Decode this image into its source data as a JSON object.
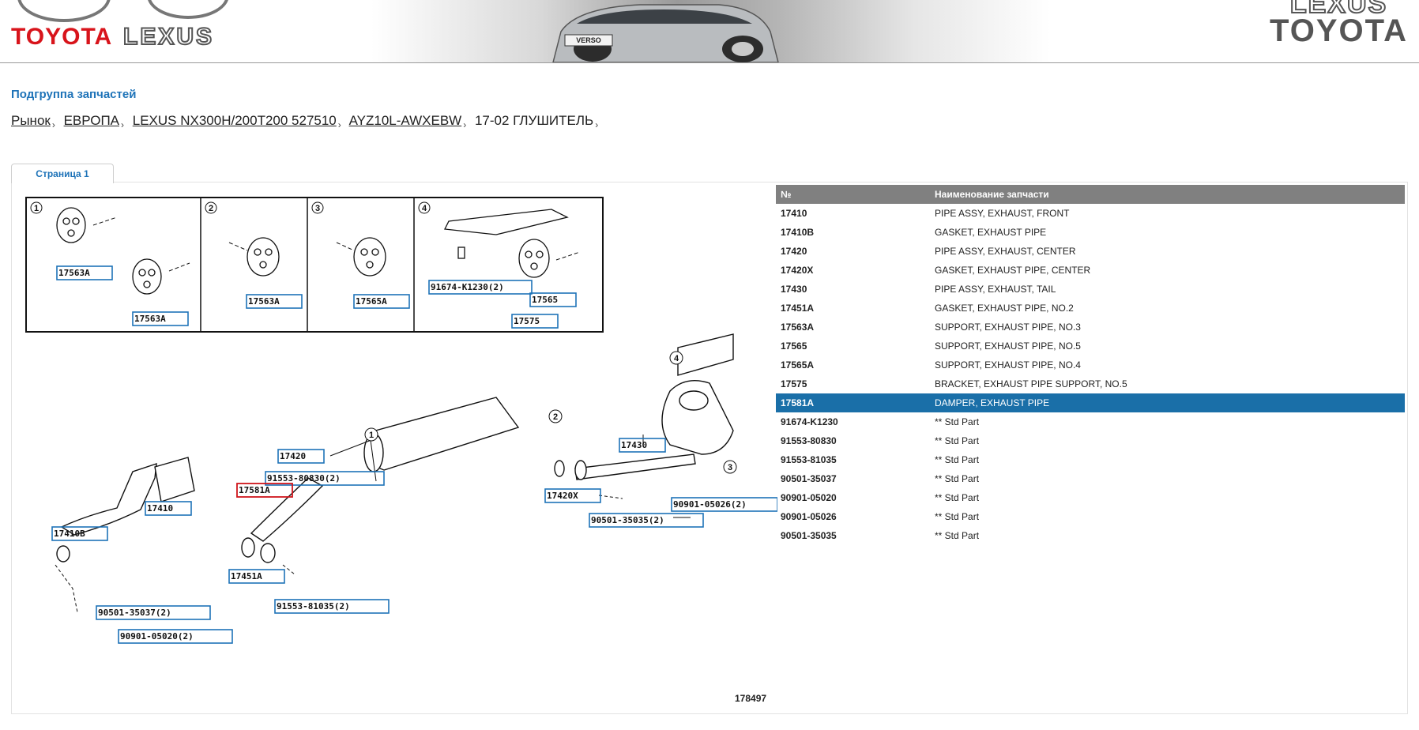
{
  "header": {
    "brand_left_1": "TOYOTA",
    "brand_left_2": "LEXUS",
    "brand_right_1": "LEXUS",
    "brand_right_2": "TOYOTA",
    "car_badge": "VERSO"
  },
  "section_title": "Подгруппа запчастей",
  "breadcrumb": [
    {
      "label": "Рынок",
      "link": true
    },
    {
      "label": "ЕВРОПА",
      "link": true
    },
    {
      "label": "LEXUS NX300H/200T200 527510",
      "link": true
    },
    {
      "label": "AYZ10L-AWXEBW",
      "link": true
    },
    {
      "label": "17-02 ГЛУШИТЕЛЬ",
      "link": false
    }
  ],
  "tabs": [
    {
      "label": "Страница 1",
      "active": true
    }
  ],
  "table": {
    "headers": [
      "№",
      "Наименование запчасти"
    ],
    "rows": [
      {
        "num": "17410",
        "name": "PIPE ASSY, EXHAUST, FRONT"
      },
      {
        "num": "17410B",
        "name": "GASKET, EXHAUST PIPE"
      },
      {
        "num": "17420",
        "name": "PIPE ASSY, EXHAUST, CENTER"
      },
      {
        "num": "17420X",
        "name": "GASKET, EXHAUST PIPE, CENTER"
      },
      {
        "num": "17430",
        "name": "PIPE ASSY, EXHAUST, TAIL"
      },
      {
        "num": "17451A",
        "name": "GASKET, EXHAUST PIPE, NO.2"
      },
      {
        "num": "17563A",
        "name": "SUPPORT, EXHAUST PIPE, NO.3"
      },
      {
        "num": "17565",
        "name": "SUPPORT, EXHAUST PIPE, NO.5"
      },
      {
        "num": "17565A",
        "name": "SUPPORT, EXHAUST PIPE, NO.4"
      },
      {
        "num": "17575",
        "name": "BRACKET, EXHAUST PIPE SUPPORT, NO.5"
      },
      {
        "num": "17581A",
        "name": "DAMPER, EXHAUST PIPE",
        "selected": true
      },
      {
        "num": "91674-K1230",
        "name": "** Std Part"
      },
      {
        "num": "91553-80830",
        "name": "** Std Part"
      },
      {
        "num": "91553-81035",
        "name": "** Std Part"
      },
      {
        "num": "90501-35037",
        "name": "** Std Part"
      },
      {
        "num": "90901-05020",
        "name": "** Std Part"
      },
      {
        "num": "90901-05026",
        "name": "** Std Part"
      },
      {
        "num": "90501-35035",
        "name": "** Std Part"
      }
    ]
  },
  "diagram": {
    "inset_numbers": [
      "1",
      "2",
      "3",
      "4"
    ],
    "callouts": [
      "17563A",
      "17563A",
      "17563A",
      "17565A",
      "91674-K1230(2)",
      "17565",
      "17575",
      "17420",
      "91553-80830(2)",
      "17581A",
      "17410",
      "17410B",
      "17451A",
      "91553-81035(2)",
      "90501-35037(2)",
      "90901-05020(2)",
      "17430",
      "17420X",
      "90901-05026(2)",
      "90501-35035(2)"
    ],
    "figure_number": "178497"
  },
  "colors": {
    "accent": "#1e73b8",
    "selected_row": "#1a6fa8",
    "table_header": "#808080",
    "highlight_callout": "#d0151b"
  }
}
